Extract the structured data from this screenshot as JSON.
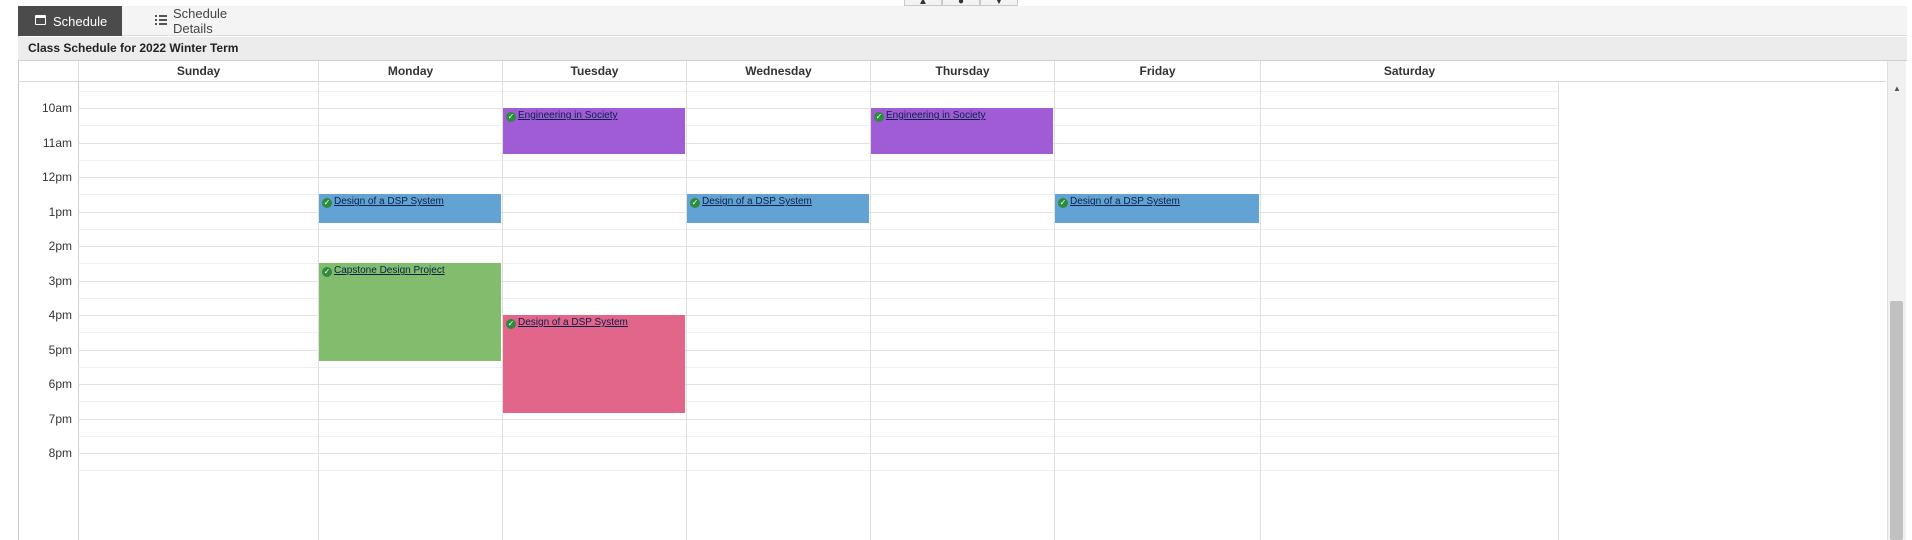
{
  "tabs": [
    {
      "label": "Schedule",
      "icon": "calendar-icon",
      "active": true
    },
    {
      "label": "Schedule Details",
      "icon": "list-icon",
      "active": false
    }
  ],
  "top_controls": [
    "▲",
    "●",
    "▼"
  ],
  "header": {
    "title": "Class Schedule for 2022 Winter Term"
  },
  "days": [
    "Sunday",
    "Monday",
    "Tuesday",
    "Wednesday",
    "Thursday",
    "Friday",
    "Saturday"
  ],
  "time_labels": [
    "10am",
    "11am",
    "12pm",
    "1pm",
    "2pm",
    "3pm",
    "4pm",
    "5pm",
    "6pm",
    "7pm",
    "8pm"
  ],
  "colors": {
    "purple": "#a05cd5",
    "blue": "#63a3d4",
    "green": "#82bc6d",
    "pink": "#e2658a",
    "check": "#2e8b3e"
  },
  "events": [
    {
      "title": "Engineering in Society",
      "day": "Tuesday",
      "start": "10:00",
      "end": "11:20",
      "color": "#a05cd5",
      "status": "check-icon"
    },
    {
      "title": "Engineering in Society",
      "day": "Thursday",
      "start": "10:00",
      "end": "11:20",
      "color": "#a05cd5",
      "status": "check-icon"
    },
    {
      "title": "Design of a DSP System",
      "day": "Monday",
      "start": "12:30",
      "end": "13:20",
      "color": "#63a3d4",
      "status": "check-icon"
    },
    {
      "title": "Design of a DSP System",
      "day": "Wednesday",
      "start": "12:30",
      "end": "13:20",
      "color": "#63a3d4",
      "status": "check-icon"
    },
    {
      "title": "Design of a DSP System",
      "day": "Friday",
      "start": "12:30",
      "end": "13:20",
      "color": "#63a3d4",
      "status": "check-icon"
    },
    {
      "title": "Capstone Design Project",
      "day": "Monday",
      "start": "14:30",
      "end": "17:20",
      "color": "#82bc6d",
      "status": "check-icon"
    },
    {
      "title": "Design of a DSP System",
      "day": "Tuesday",
      "start": "16:00",
      "end": "18:50",
      "color": "#e2658a",
      "status": "check-icon"
    }
  ]
}
